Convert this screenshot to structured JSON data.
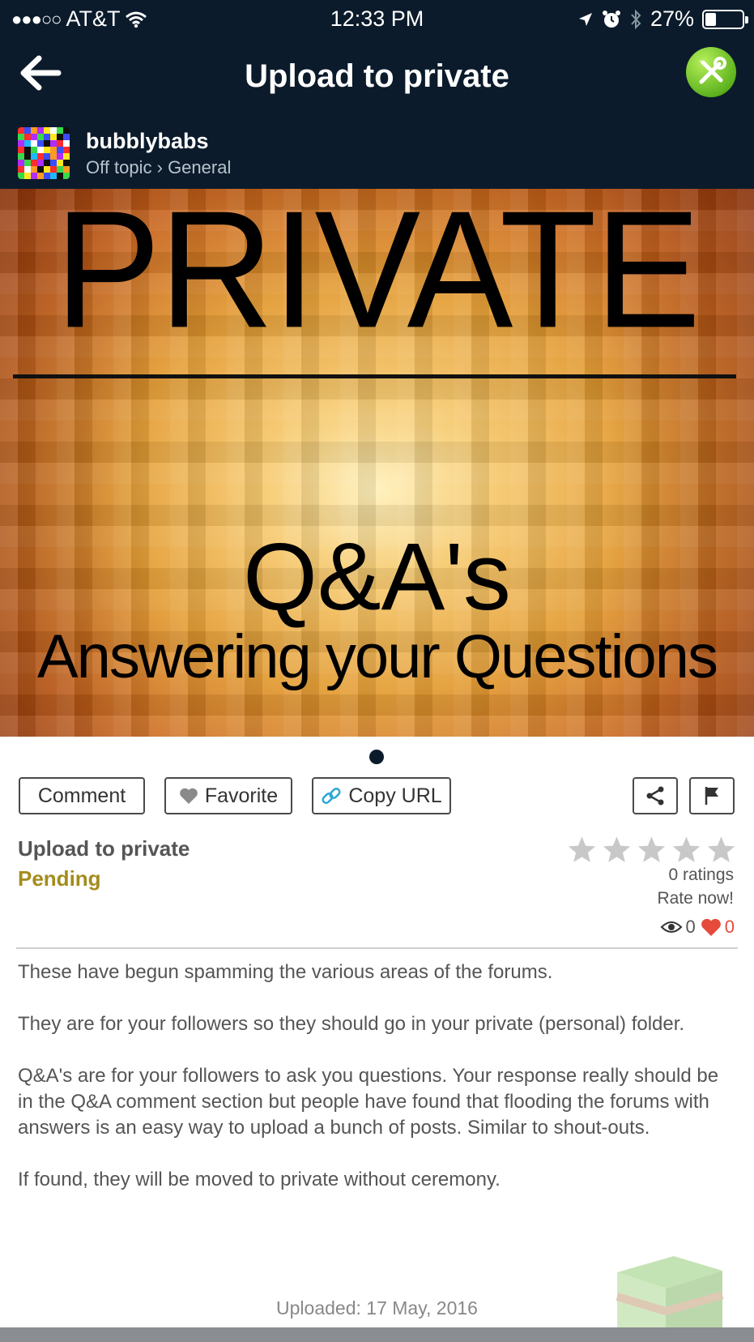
{
  "status_bar": {
    "signal": "●●●○○",
    "carrier": "AT&T",
    "time": "12:33 PM",
    "battery_percent": "27%",
    "battery_level": 0.27,
    "icons": [
      "wifi-icon",
      "location-arrow-icon",
      "alarm-icon",
      "bluetooth-icon",
      "battery-icon"
    ]
  },
  "header": {
    "title": "Upload to private",
    "back_icon": "arrow-left-icon",
    "tools_icon": "wrench-screwdriver-icon",
    "tools_color": "#6cc428",
    "background": "#0b1b2b"
  },
  "author": {
    "name": "bubblybabs",
    "category": "Off topic › General"
  },
  "banner": {
    "title": "PRIVATE",
    "qa": "Q&A's",
    "subtitle": "Answering your Questions"
  },
  "pager": {
    "page": 1,
    "total": 1
  },
  "actions": {
    "comment": "Comment",
    "favorite": "Favorite",
    "copy_url": "Copy URL",
    "share_icon": "share-icon",
    "flag_icon": "flag-icon"
  },
  "post": {
    "title": "Upload to private",
    "status": "Pending",
    "status_color": "#a48c1c",
    "stars_filled": 0,
    "stars_total": 5,
    "ratings": "0 ratings",
    "rate_now": "Rate now!",
    "views": "0",
    "favorites": "0",
    "paragraphs": [
      "These have begun spamming the various areas of the forums.",
      "They are for your followers so they should go in your private (personal) folder.",
      "Q&A's are for your followers to ask you questions.  Your response really should be in the Q&A comment section but people have found that flooding the forums with answers is an easy way to upload a bunch of posts.  Similar to shout-outs.",
      "If found, they will be moved to private without ceremony."
    ],
    "uploaded": "Uploaded: 17 May, 2016"
  }
}
